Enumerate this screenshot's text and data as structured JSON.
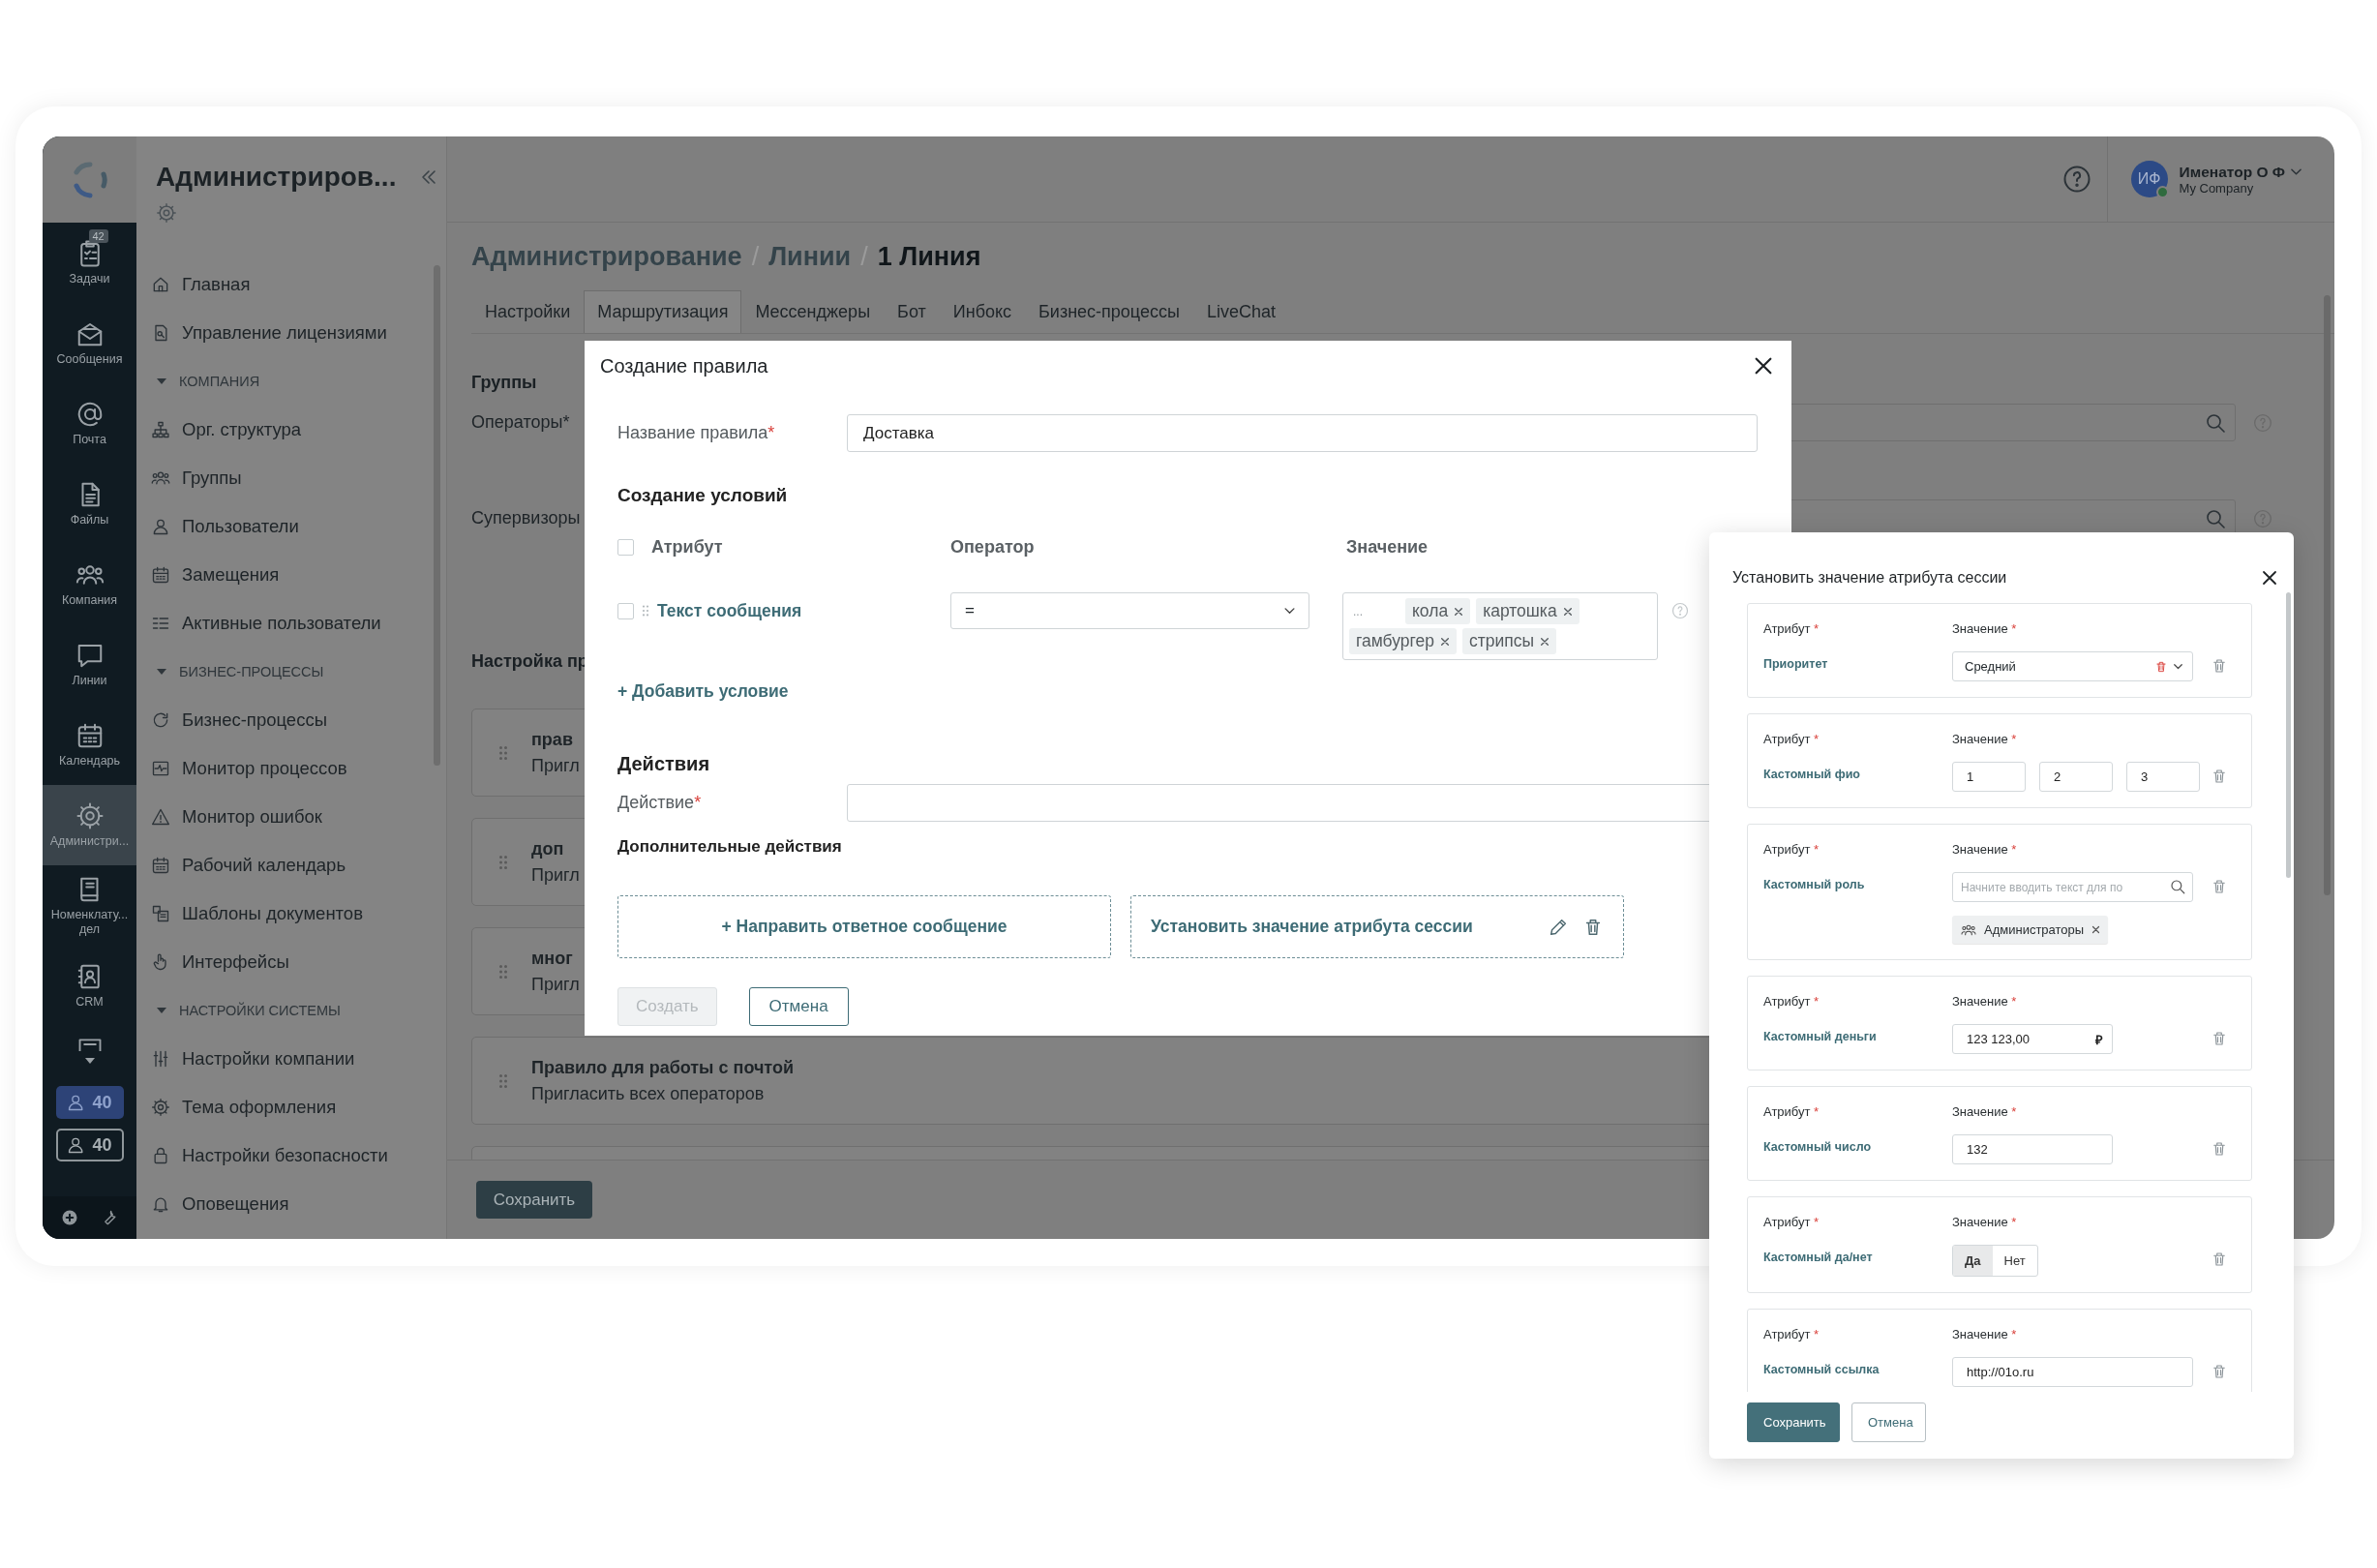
{
  "rail": {
    "items": [
      {
        "label": "Задачи",
        "badge": "42",
        "selected": false
      },
      {
        "label": "Сообщения",
        "selected": false
      },
      {
        "label": "Почта",
        "selected": false
      },
      {
        "label": "Файлы",
        "selected": false
      },
      {
        "label": "Компания",
        "selected": false
      },
      {
        "label": "Линии",
        "selected": false
      },
      {
        "label": "Календарь",
        "selected": false
      },
      {
        "label": "Администри...",
        "selected": true
      },
      {
        "label": "Номенклату...\nдел",
        "selected": false
      },
      {
        "label": "CRM",
        "selected": false
      }
    ],
    "counters": [
      {
        "kind": "filled",
        "value": "40"
      },
      {
        "kind": "outline",
        "value": "40"
      }
    ]
  },
  "sidebar": {
    "title": "Администриров...",
    "items": [
      {
        "kind": "link",
        "label": "Главная"
      },
      {
        "kind": "link",
        "label": "Управление лицензиями"
      },
      {
        "kind": "section",
        "label": "КОМПАНИЯ",
        "expanded": true
      },
      {
        "kind": "link",
        "label": "Орг. структура"
      },
      {
        "kind": "link",
        "label": "Группы"
      },
      {
        "kind": "link",
        "label": "Пользователи"
      },
      {
        "kind": "link",
        "label": "Замещения"
      },
      {
        "kind": "link",
        "label": "Активные пользователи"
      },
      {
        "kind": "section",
        "label": "БИЗНЕС-ПРОЦЕССЫ",
        "expanded": true
      },
      {
        "kind": "link",
        "label": "Бизнес-процессы"
      },
      {
        "kind": "link",
        "label": "Монитор процессов"
      },
      {
        "kind": "link",
        "label": "Монитор ошибок"
      },
      {
        "kind": "link",
        "label": "Рабочий календарь"
      },
      {
        "kind": "link",
        "label": "Шаблоны документов"
      },
      {
        "kind": "link",
        "label": "Интерфейсы"
      },
      {
        "kind": "section",
        "label": "НАСТРОЙКИ СИСТЕМЫ",
        "expanded": true
      },
      {
        "kind": "link",
        "label": "Настройки компании"
      },
      {
        "kind": "link",
        "label": "Тема оформления"
      },
      {
        "kind": "link",
        "label": "Настройки безопасности"
      },
      {
        "kind": "link",
        "label": "Оповещения"
      }
    ]
  },
  "header": {
    "user": {
      "initials": "ИФ",
      "name": "Именатор О Ф",
      "company": "My Company",
      "online": true
    }
  },
  "breadcrumb": {
    "separator": "/",
    "items": [
      "Администрирование",
      "Линии",
      "1 Линия"
    ]
  },
  "tabs": [
    {
      "label": "Настройки",
      "selected": false
    },
    {
      "label": "Маршрутизация",
      "selected": true
    },
    {
      "label": "Мессенджеры",
      "selected": false
    },
    {
      "label": "Бот",
      "selected": false
    },
    {
      "label": "Инбокс",
      "selected": false
    },
    {
      "label": "Бизнес-процессы",
      "selected": false
    },
    {
      "label": "LiveChat",
      "selected": false
    }
  ],
  "routing": {
    "groups_title": "Группы",
    "fields": [
      {
        "label": "Операторы*"
      },
      {
        "label": "Супервизоры"
      }
    ],
    "rules_title": "Настройка пр",
    "rules": [
      {
        "title": "прав",
        "subtitle": "Пригл"
      },
      {
        "title": "доп",
        "subtitle": "Пригл"
      },
      {
        "title": "мног",
        "subtitle": "Пригл"
      },
      {
        "title": "Правило для работы с почтой",
        "subtitle": "Пригласить всех операторов"
      }
    ],
    "save_button": "Сохранить"
  },
  "rule_modal": {
    "title": "Создание правила",
    "name_field": {
      "label": "Название правила",
      "mark": "*",
      "value": "Доставка"
    },
    "conditions_title": "Создание условий",
    "condition_header": {
      "checked": false,
      "columns": [
        "Атрибут",
        "Оператор",
        "Значение"
      ]
    },
    "conditions": [
      {
        "checked": false,
        "attribute": "Текст сообщения",
        "operator": "=",
        "placeholder": "...",
        "tags": [
          "кола",
          "картошка",
          "гамбургер",
          "стрипсы"
        ]
      }
    ],
    "add_condition": "+ Добавить условие",
    "actions_title": "Действия",
    "action_field": {
      "label": "Действие",
      "mark": "*"
    },
    "extra_title": "Дополнительные действия",
    "extra_actions": [
      {
        "kind": "add",
        "label": "+ Направить ответное сообщение"
      },
      {
        "kind": "item",
        "label": "Установить значение атрибута сессии"
      }
    ],
    "buttons": [
      {
        "kind": "primary",
        "label": "Создать",
        "disabled": true
      },
      {
        "kind": "secondary",
        "label": "Отмена",
        "disabled": false
      }
    ]
  },
  "attribute_panel": {
    "title": "Установить значение атрибута сессии",
    "rows": [
      {
        "kind": "select",
        "attribute_label": "Атрибут",
        "value_label": "Значение",
        "mark": "*",
        "attribute": "Приоритет",
        "value": "Средний"
      },
      {
        "kind": "triple",
        "attribute_label": "Атрибут",
        "value_label": "Значение",
        "mark": "*",
        "attribute": "Кастомный фио",
        "values": [
          "1",
          "2",
          "3"
        ]
      },
      {
        "kind": "search",
        "attribute_label": "Атрибут",
        "value_label": "Значение",
        "mark": "*",
        "attribute": "Кастомный роль",
        "placeholder": "Начните вводить текст для по",
        "chips": [
          "Администраторы"
        ]
      },
      {
        "kind": "money",
        "attribute_label": "Атрибут",
        "value_label": "Значение",
        "mark": "*",
        "attribute": "Кастомный деньги",
        "value": "123 123,00",
        "currency": "₽"
      },
      {
        "kind": "number",
        "attribute_label": "Атрибут",
        "value_label": "Значение",
        "mark": "*",
        "attribute": "Кастомный число",
        "value": "132"
      },
      {
        "kind": "toggle",
        "attribute_label": "Атрибут",
        "value_label": "Значение",
        "mark": "*",
        "attribute": "Кастомный да/нет",
        "options": [
          {
            "label": "Да",
            "selected": true
          },
          {
            "label": "Нет",
            "selected": false
          }
        ]
      },
      {
        "kind": "link",
        "attribute_label": "Атрибут",
        "value_label": "Значение",
        "mark": "*",
        "attribute": "Кастомный ссылка",
        "value": "http://01o.ru"
      }
    ],
    "buttons": [
      {
        "kind": "primary",
        "label": "Сохранить"
      },
      {
        "kind": "secondary",
        "label": "Отмена"
      }
    ]
  }
}
